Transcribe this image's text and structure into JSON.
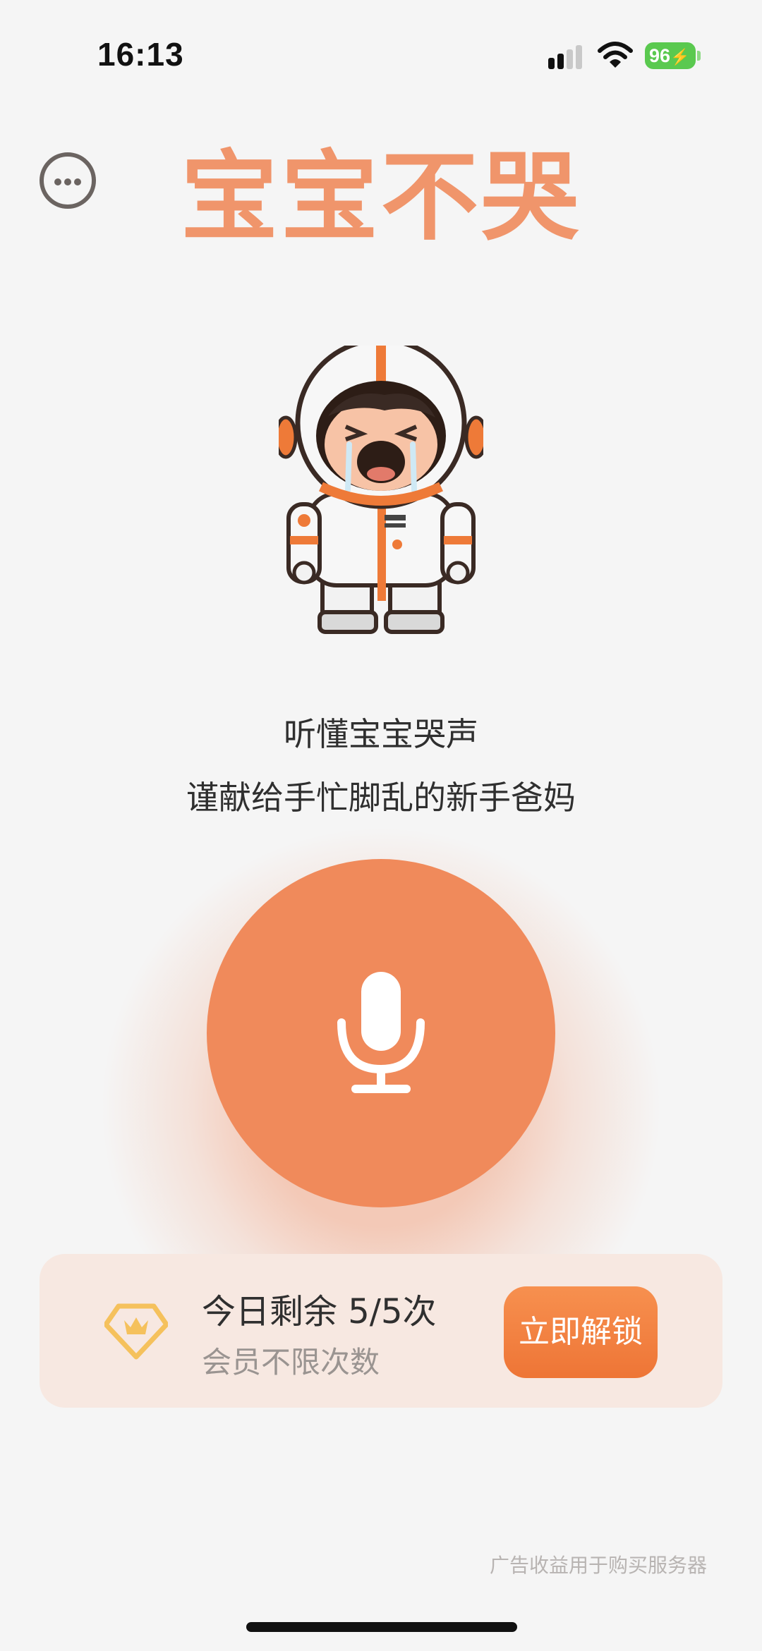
{
  "status_bar": {
    "time": "16:13",
    "battery": "96",
    "icons": [
      "signal-icon",
      "wifi-icon",
      "battery-charging-icon"
    ]
  },
  "header": {
    "title": "宝宝不哭",
    "menu_icon": "more-icon"
  },
  "main": {
    "tagline_line1": "听懂宝宝哭声",
    "tagline_line2": "谨献给手忙脚乱的新手爸妈",
    "record_icon": "microphone-icon"
  },
  "quota_card": {
    "remaining": "今日剩余 5/5次",
    "subtitle": "会员不限次数",
    "unlock_label": "立即解锁",
    "icon": "vip-crown-icon"
  },
  "footer": {
    "note": "广告收益用于购买服务器"
  },
  "colors": {
    "accent": "#f08a5b",
    "title": "#f0956b",
    "card_bg": "#f7e8e1",
    "vip": "#f5c15c"
  }
}
